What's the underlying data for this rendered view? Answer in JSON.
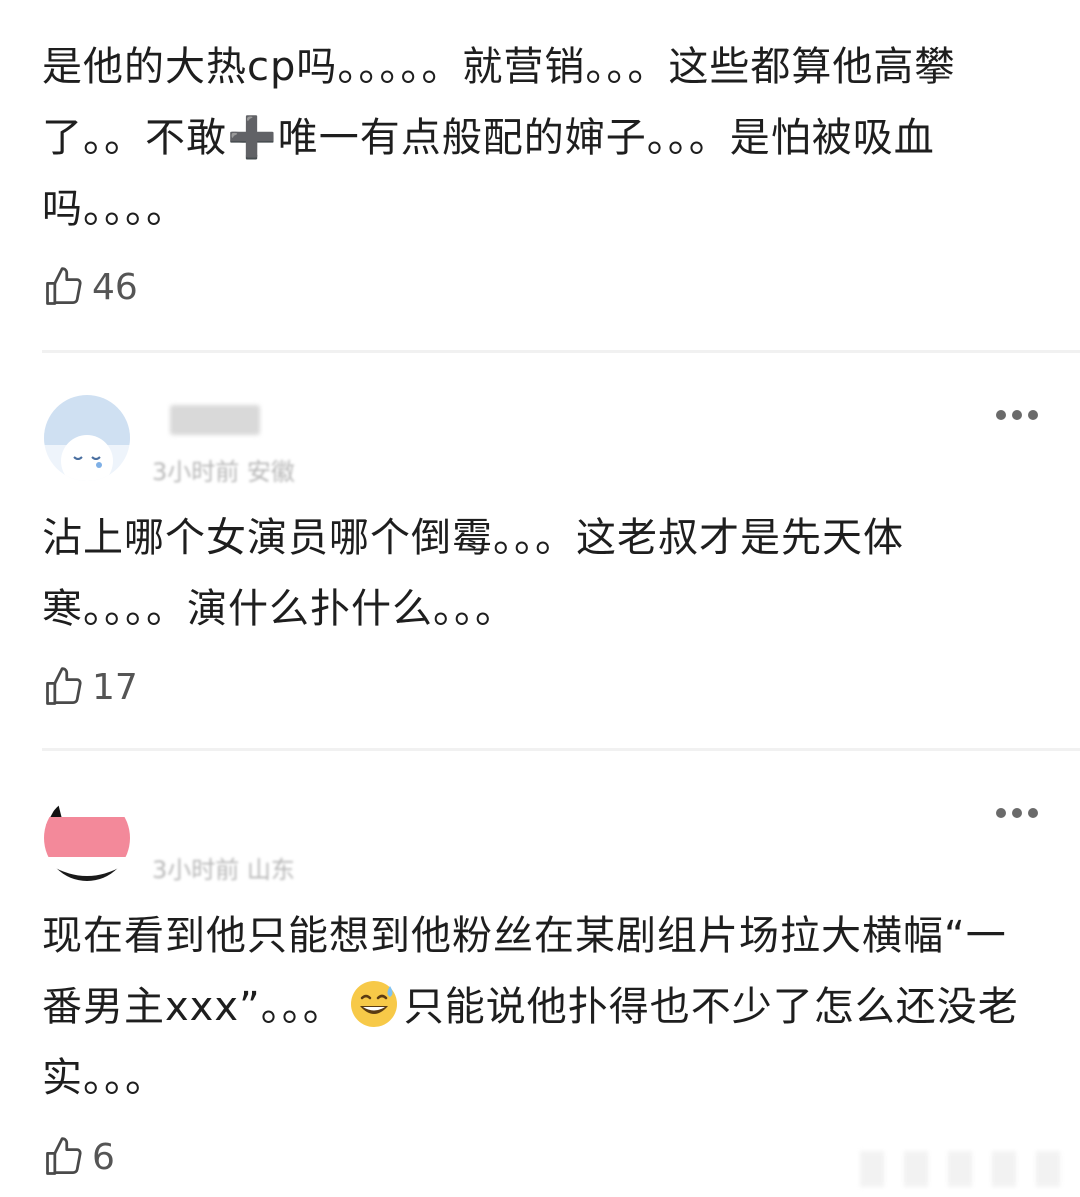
{
  "comments": [
    {
      "text": "是他的大热cp吗。。。。。就营销。。。这些都算他高攀了。。不敢➕唯一有点般配的婶子。。。是怕被吸血吗。。。。",
      "likes": "46"
    },
    {
      "meta": "3小时前 安徽",
      "text_before_emoji": "沾上哪个女演员哪个倒霉。。。这老叔才是先天体寒。。。。演什么扑什么。。。",
      "likes": "17"
    },
    {
      "meta": "3小时前 山东",
      "text_before_emoji": "现在看到他只能想到他粉丝在某剧组片场拉大横幅“一番男主xxx”。。。",
      "emoji": "sweat-smile-emoji",
      "text_after_emoji": "只能说他扑得也不少了怎么还没老实。。。",
      "likes": "6"
    }
  ],
  "icons": {
    "like": "thumbs-up-icon",
    "more": "more-dots-icon"
  },
  "colors": {
    "text": "#1e1e1e",
    "secondary": "#555555",
    "divider": "#f1f1f1"
  }
}
